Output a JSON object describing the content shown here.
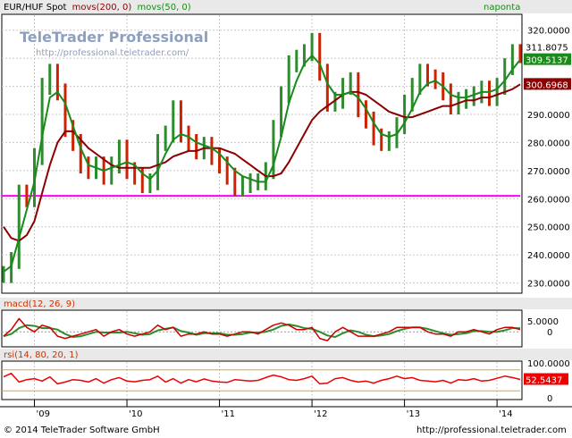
{
  "main": {
    "title_prefix": "EUR/HUF Spot",
    "ma_long_label": "movs(200, 0)",
    "ma_short_label": "movs(50, 0)",
    "period_label": "naponta",
    "watermark_title": "TeleTrader Professional",
    "watermark_url": "http://professional.teletrader.com/"
  },
  "macd": {
    "label": "macd(12, 26, 9)"
  },
  "rsi": {
    "label": "rsi(14, 80, 20, 1)"
  },
  "footer": {
    "copyright": "© 2014 TeleTrader Software GmbH",
    "url": "http://professional.teletrader.com"
  },
  "colors": {
    "price_up": "#2e8b2e",
    "price_down": "#cc2200",
    "ma_short": "#1a8a1a",
    "ma_long": "#8b0000",
    "support": "#ff00ff",
    "macd_line": "#cc0000",
    "macd_signal": "#2e8b2e",
    "rsi_line": "#ee0000",
    "rsi_band": "#e0a040",
    "label_text": "#cc3300"
  },
  "chart_data": [
    {
      "type": "line",
      "series": [
        {
          "name": "EUR/HUF Spot",
          "x": [
            "2008-09",
            "2008-10",
            "2008-11",
            "2008-12",
            "2009-01",
            "2009-02",
            "2009-03",
            "2009-04",
            "2009-05",
            "2009-06",
            "2009-07",
            "2009-08",
            "2009-09",
            "2009-10",
            "2009-11",
            "2009-12",
            "2010-01",
            "2010-02",
            "2010-03",
            "2010-04",
            "2010-05",
            "2010-06",
            "2010-07",
            "2010-08",
            "2010-09",
            "2010-10",
            "2010-11",
            "2010-12",
            "2011-01",
            "2011-02",
            "2011-03",
            "2011-04",
            "2011-05",
            "2011-06",
            "2011-07",
            "2011-08",
            "2011-09",
            "2011-10",
            "2011-11",
            "2011-12",
            "2012-01",
            "2012-02",
            "2012-03",
            "2012-04",
            "2012-05",
            "2012-06",
            "2012-07",
            "2012-08",
            "2012-09",
            "2012-10",
            "2012-11",
            "2012-12",
            "2013-01",
            "2013-02",
            "2013-03",
            "2013-04",
            "2013-05",
            "2013-06",
            "2013-07",
            "2013-08",
            "2013-09",
            "2013-10",
            "2013-11",
            "2013-12",
            "2014-01",
            "2014-02",
            "2014-03",
            "2014-04"
          ],
          "values": [
            233,
            238,
            262,
            260,
            275,
            300,
            305,
            298,
            285,
            280,
            272,
            270,
            272,
            268,
            272,
            278,
            270,
            268,
            265,
            266,
            280,
            283,
            292,
            283,
            280,
            277,
            279,
            275,
            272,
            268,
            264,
            265,
            266,
            266,
            270,
            285,
            297,
            308,
            310,
            312,
            316,
            305,
            294,
            295,
            300,
            302,
            292,
            288,
            282,
            280,
            281,
            286,
            294,
            300,
            305,
            303,
            302,
            298,
            293,
            295,
            296,
            297,
            299,
            296,
            300,
            307,
            312,
            311.3
          ]
        },
        {
          "name": "movs(50, 0)",
          "values": [
            234,
            236,
            246,
            256,
            266,
            282,
            296,
            298,
            294,
            286,
            278,
            272,
            271,
            270,
            271,
            272,
            273,
            272,
            269,
            267,
            270,
            276,
            281,
            283,
            282,
            280,
            279,
            278,
            276,
            273,
            270,
            268,
            267,
            266,
            266,
            272,
            282,
            294,
            302,
            308,
            311,
            308,
            301,
            297,
            297,
            298,
            296,
            292,
            287,
            283,
            282,
            283,
            287,
            292,
            298,
            301,
            302,
            300,
            297,
            296,
            296,
            297,
            298,
            298,
            299,
            302,
            306,
            309.5
          ]
        },
        {
          "name": "movs(200, 0)",
          "values": [
            250,
            246,
            245,
            247,
            252,
            262,
            272,
            280,
            284,
            284,
            281,
            278,
            276,
            274,
            272,
            271,
            271,
            271,
            271,
            271,
            272,
            273,
            275,
            276,
            277,
            277,
            278,
            278,
            278,
            277,
            276,
            274,
            272,
            270,
            268,
            268,
            269,
            273,
            278,
            283,
            288,
            291,
            293,
            295,
            297,
            298,
            298,
            297,
            295,
            293,
            291,
            290,
            289,
            289,
            290,
            291,
            292,
            293,
            293,
            294,
            295,
            295,
            296,
            296,
            297,
            298,
            299,
            300.7
          ]
        }
      ],
      "support_level": 261,
      "last_values": {
        "price": "311.8075",
        "ma_short": "309.5137",
        "ma_long": "300.6968"
      },
      "y_ticks": [
        "230.0000",
        "240.0000",
        "250.0000",
        "260.0000",
        "270.0000",
        "280.0000",
        "290.0000",
        "300.0000",
        "310.0000",
        "320.0000"
      ],
      "ylim": [
        227,
        325
      ],
      "x_ticks": [
        "'09",
        "'10",
        "'11",
        "'12",
        "'13",
        "'14"
      ],
      "grid": true
    },
    {
      "type": "line",
      "series": [
        {
          "name": "macd(12, 26, 9)",
          "values": [
            -2,
            1,
            6,
            2,
            0,
            3,
            2,
            -2,
            -3,
            -2,
            -1,
            0,
            1,
            -2,
            0,
            1,
            -1,
            -2,
            -1,
            0,
            3,
            1,
            2,
            -2,
            -1,
            -1,
            0,
            -1,
            -1,
            -2,
            -1,
            0,
            0,
            -1,
            1,
            3,
            4,
            3,
            1,
            1,
            2,
            -3,
            -4,
            0,
            2,
            0,
            -2,
            -2,
            -2,
            -1,
            0,
            2,
            2,
            2,
            2,
            0,
            -1,
            -1,
            -2,
            0,
            0,
            1,
            0,
            -1,
            1,
            2,
            2,
            1
          ]
        }
      ],
      "y_ticks": [
        "5.0000",
        "0"
      ],
      "ylim": [
        -6,
        9
      ]
    },
    {
      "type": "line",
      "series": [
        {
          "name": "rsi(14, 80, 20, 1)",
          "values": [
            60,
            70,
            45,
            52,
            55,
            48,
            60,
            40,
            45,
            52,
            50,
            45,
            55,
            42,
            52,
            58,
            48,
            46,
            50,
            52,
            62,
            45,
            55,
            42,
            52,
            46,
            54,
            48,
            45,
            44,
            52,
            50,
            48,
            50,
            58,
            65,
            60,
            52,
            50,
            55,
            62,
            40,
            42,
            55,
            58,
            50,
            45,
            48,
            42,
            50,
            55,
            62,
            55,
            58,
            50,
            48,
            46,
            50,
            42,
            52,
            50,
            55,
            48,
            50,
            56,
            62,
            58,
            52.5
          ]
        }
      ],
      "y_ticks": [
        "100.0000",
        "0"
      ],
      "bands": [
        80,
        20
      ],
      "last_value": "52.5437",
      "ylim": [
        0,
        100
      ]
    }
  ]
}
